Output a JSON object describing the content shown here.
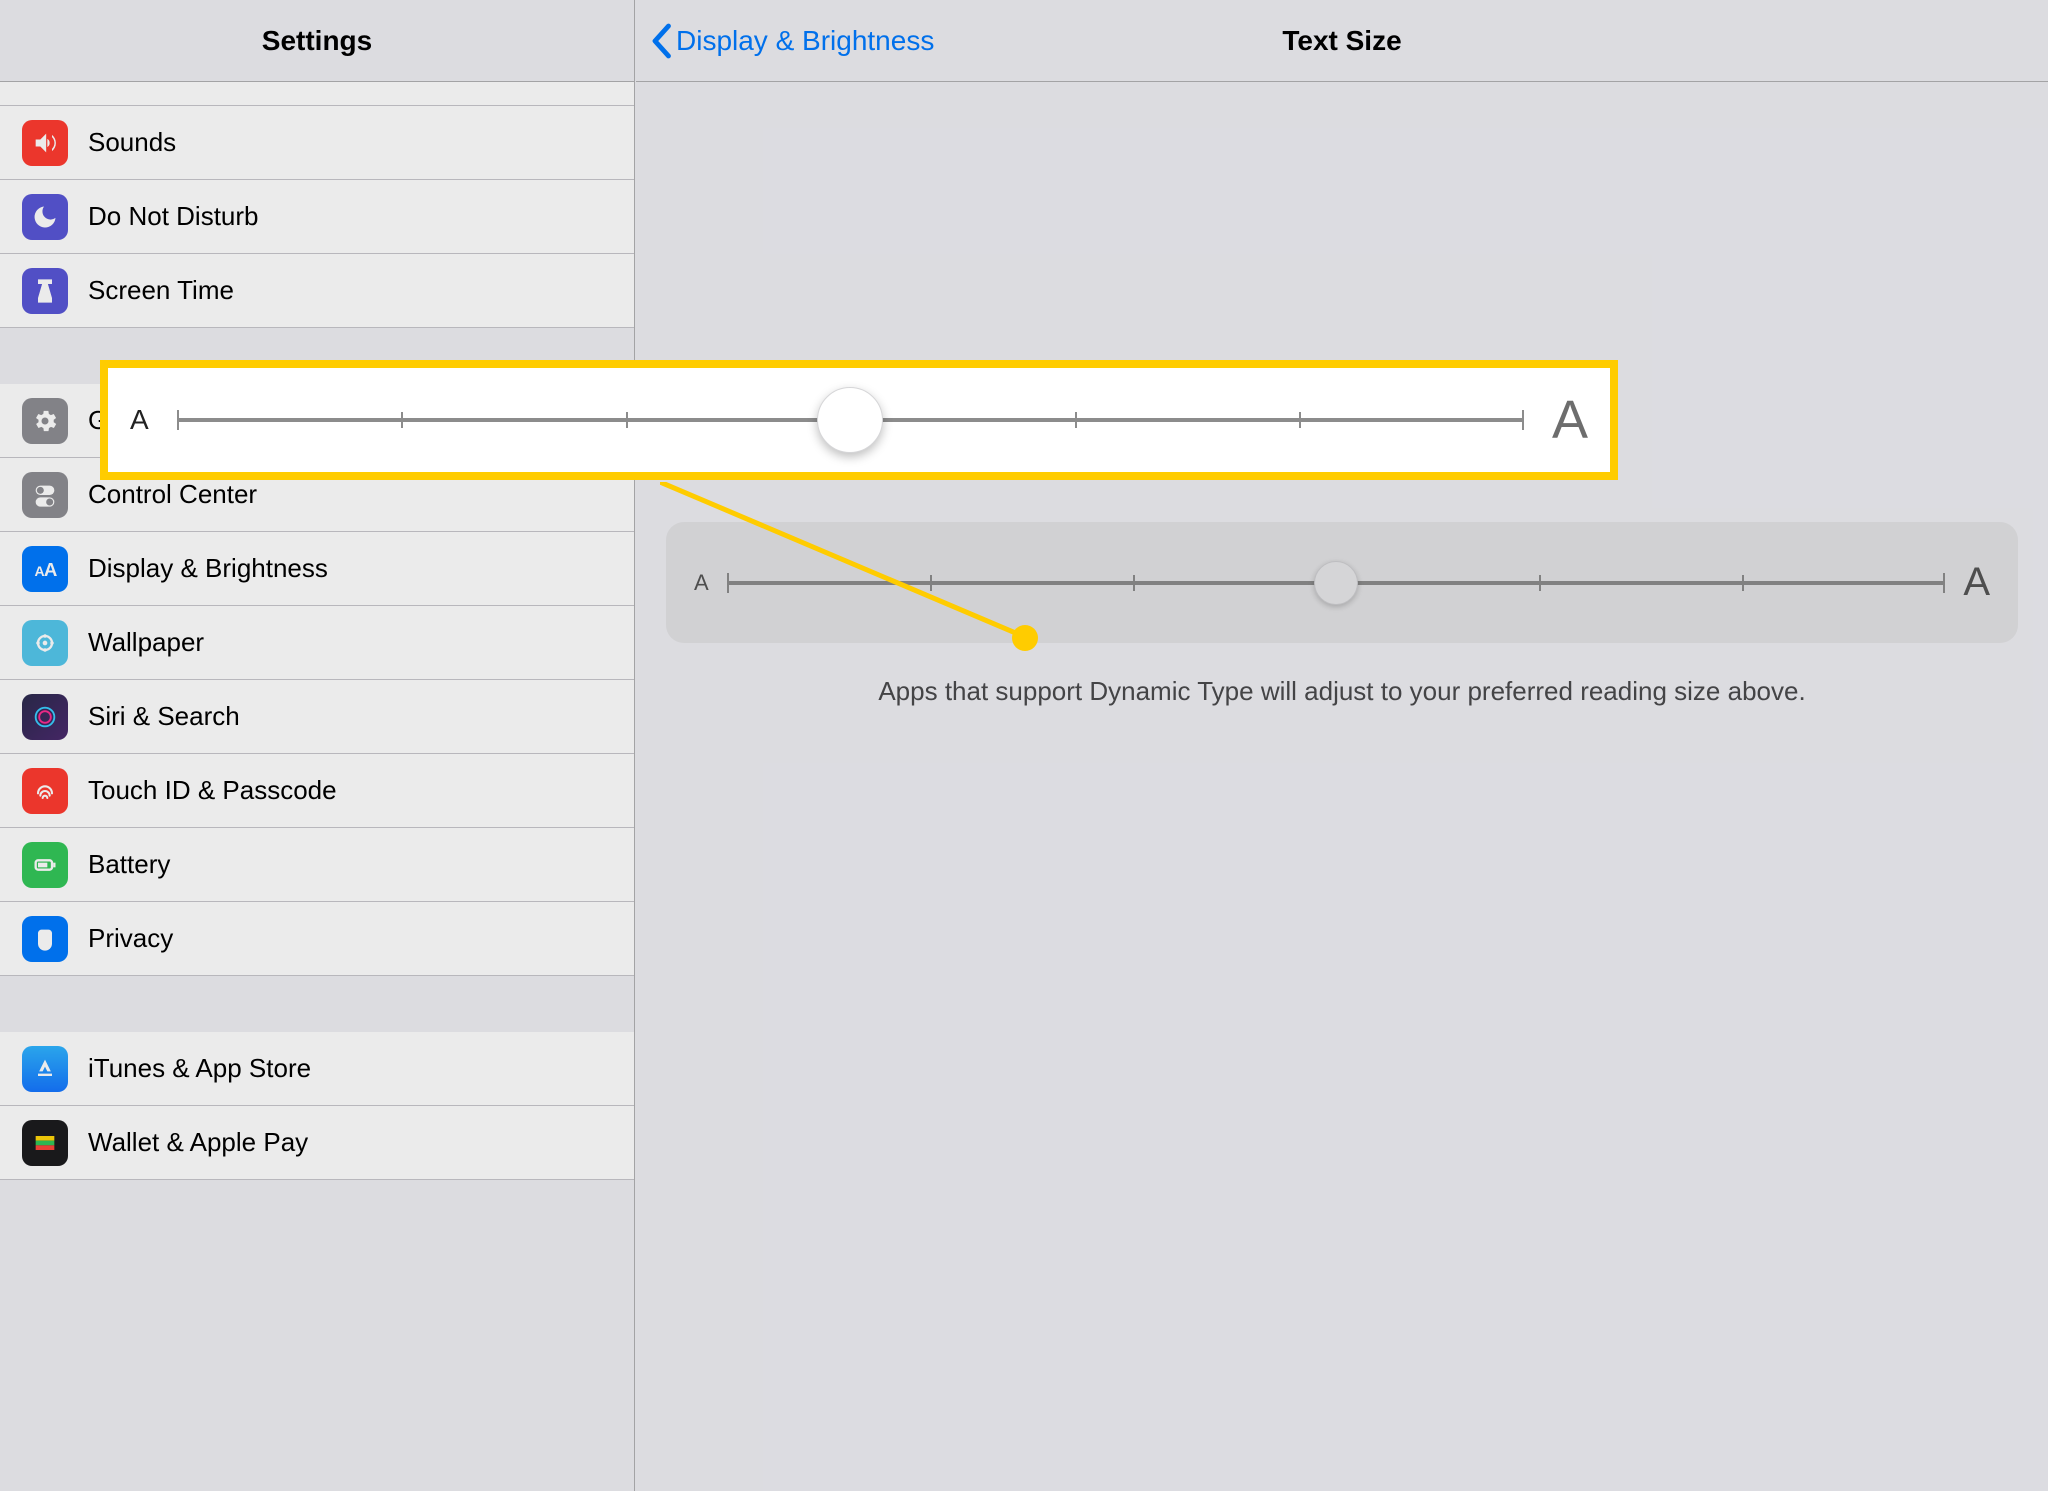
{
  "sidebar": {
    "title": "Settings",
    "groups": [
      {
        "items": [
          {
            "label": "Sounds",
            "iconName": "sounds-icon",
            "iconBg": "#ff3b30"
          },
          {
            "label": "Do Not Disturb",
            "iconName": "dnd-icon",
            "iconBg": "#5856d6"
          },
          {
            "label": "Screen Time",
            "iconName": "screen-time-icon",
            "iconBg": "#5856d6"
          }
        ]
      },
      {
        "items": [
          {
            "label": "General",
            "iconName": "general-icon",
            "iconBg": "#8e8e93"
          },
          {
            "label": "Control Center",
            "iconName": "control-center-icon",
            "iconBg": "#8e8e93"
          },
          {
            "label": "Display & Brightness",
            "iconName": "display-icon",
            "iconBg": "#007aff"
          },
          {
            "label": "Wallpaper",
            "iconName": "wallpaper-icon",
            "iconBg": "#54c7ec"
          },
          {
            "label": "Siri & Search",
            "iconName": "siri-icon",
            "iconBg": "#1c1c1e"
          },
          {
            "label": "Touch ID & Passcode",
            "iconName": "touchid-icon",
            "iconBg": "#ff3b30"
          },
          {
            "label": "Battery",
            "iconName": "battery-icon",
            "iconBg": "#34c759"
          },
          {
            "label": "Privacy",
            "iconName": "privacy-icon",
            "iconBg": "#007aff"
          }
        ]
      },
      {
        "items": [
          {
            "label": "iTunes & App Store",
            "iconName": "appstore-icon",
            "iconBg": "#1e90ff"
          },
          {
            "label": "Wallet & Apple Pay",
            "iconName": "wallet-icon",
            "iconBg": "#1c1c1e"
          }
        ]
      }
    ]
  },
  "detail": {
    "backLabel": "Display & Brightness",
    "title": "Text Size",
    "description": "Apps that support Dynamic Type will adjust to your preferred reading size above.",
    "slider": {
      "smallLabel": "A",
      "largeLabel": "A",
      "stops": 7,
      "detailValueIndex": 3,
      "highlightValueIndex": 3
    }
  }
}
